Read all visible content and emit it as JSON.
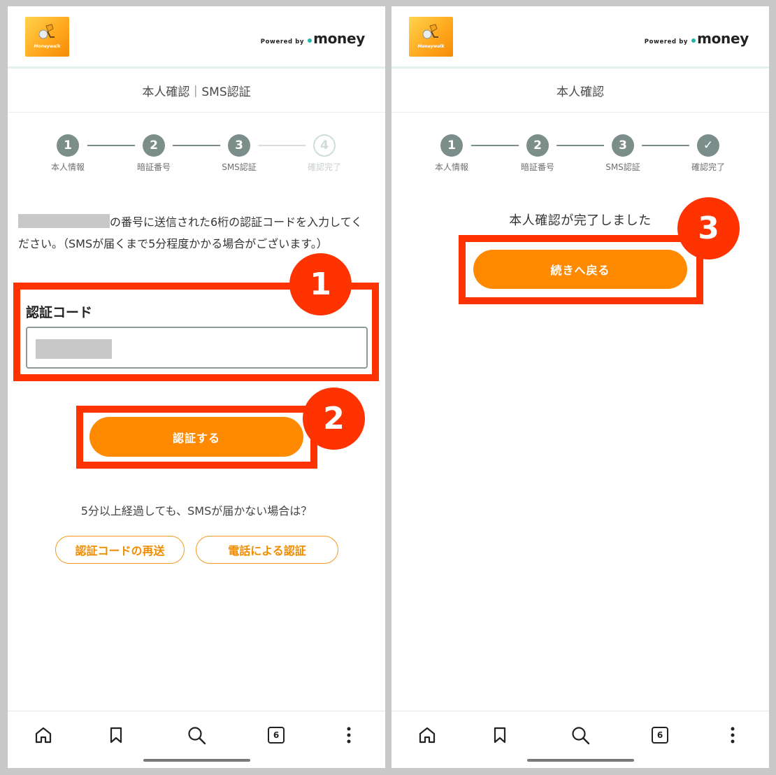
{
  "brand": {
    "logo_text": "Moneywalk",
    "powered_by": "Powered by",
    "money_word": "money",
    "accent": "#ff8a00",
    "highlight": "#ff3300",
    "step_done_color": "#7b8e8a"
  },
  "left": {
    "page_title": "本人確認｜SMS認証",
    "steps": [
      {
        "num": "1",
        "label": "本人情報"
      },
      {
        "num": "2",
        "label": "暗証番号"
      },
      {
        "num": "3",
        "label": "SMS認証"
      },
      {
        "num": "4",
        "label": "確認完了"
      }
    ],
    "desc_rest": "の番号に送信された6桁の認証コードを入力してください。（SMSが届くまで5分程度かかる場合がございます。）",
    "field_label": "認証コード",
    "submit_label": "認証する",
    "sms_note": "5分以上経過しても、SMSが届かない場合は？",
    "resend_label": "認証コードの再送",
    "phone_label": "電話による認証"
  },
  "right": {
    "page_title": "本人確認",
    "steps": [
      {
        "num": "1",
        "label": "本人情報"
      },
      {
        "num": "2",
        "label": "暗証番号"
      },
      {
        "num": "3",
        "label": "SMS認証"
      },
      {
        "num": "✓",
        "label": "確認完了"
      }
    ],
    "complete_message": "本人確認が完了しました",
    "continue_label": "続きへ戻る"
  },
  "nav": {
    "items": [
      "home-icon",
      "bookmark-icon",
      "search-icon",
      "tabs-icon",
      "more-icon"
    ],
    "tab_count": "6"
  },
  "annotations": {
    "badge1": "1",
    "badge2": "2",
    "badge3": "3"
  }
}
